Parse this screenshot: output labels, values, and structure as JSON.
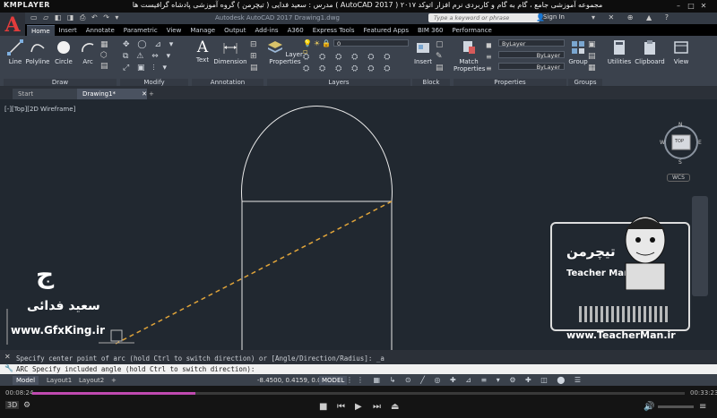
{
  "player": {
    "logo": "KMPLAYER",
    "title": "مجموعه آموزشی جامع ، گام به گام و کاربردی نرم افزار اتوکد ۲۰۱۷ ( AutoCAD 2017 ) مدرس : سعید فدایی ( تیچرمن ) گروه آموزشی پادشاه گرافیست ها",
    "time_elapsed": "00:08:24",
    "time_total": "00:33:23",
    "progress": 0.25
  },
  "acad": {
    "title": "Autodesk AutoCAD 2017    Drawing1.dwg",
    "search_placeholder": "Type a keyword or phrase",
    "signin": "Sign In",
    "tabs": [
      "Home",
      "Insert",
      "Annotate",
      "Parametric",
      "View",
      "Manage",
      "Output",
      "Add-ins",
      "A360",
      "Express Tools",
      "Featured Apps",
      "BIM 360",
      "Performance"
    ]
  },
  "ribbon": {
    "draw_tools": [
      "Line",
      "Polyline",
      "Circle",
      "Arc"
    ],
    "text_tools": [
      "Text",
      "Dimension"
    ],
    "layer_props": "Layer\nProperties",
    "layer_current": "0",
    "insert": "Insert",
    "match": "Match\nProperties",
    "bylayer": [
      "ByLayer",
      "ByLayer",
      "ByLayer"
    ],
    "group": "Group",
    "utilities": "Utilities",
    "clipboard": "Clipboard",
    "view": "View",
    "panels": [
      "Draw",
      "Modify",
      "Annotation",
      "Layers",
      "Block",
      "Properties",
      "Groups"
    ]
  },
  "filetabs": [
    "Start",
    "Drawing1*"
  ],
  "viewport": {
    "label": "[-][Top][2D Wireframe]",
    "viewcube": {
      "top": "TOP",
      "n": "N",
      "s": "S",
      "e": "E",
      "w": "W",
      "wcs": "WCS"
    }
  },
  "command": {
    "history": "Specify center point of arc (hold Ctrl to switch direction) or [Angle/Direction/Radius]: _a",
    "prompt": "ARC Specify included angle (hold Ctrl to switch direction):"
  },
  "status": {
    "layout_tabs": [
      "Model",
      "Layout1",
      "Layout2"
    ],
    "coords": "-8.4500, 0.4159, 0.0000",
    "model": "MODEL"
  },
  "watermarks": {
    "name_fa": "سعید فدائی",
    "site_left": "www.GfxKing.ir",
    "brand_fa": "تیچرمن",
    "brand_en": "Teacher Man",
    "site_right": "www.TeacherMan.ir"
  },
  "colors": {
    "viewport_bg": "#212830",
    "ribbon_bg": "#3b424d",
    "dashed_line": "#e0a43a",
    "seek_accent": "#c04ab0"
  }
}
